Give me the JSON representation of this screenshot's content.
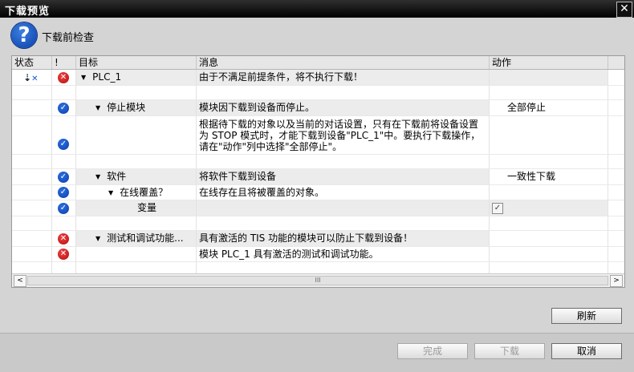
{
  "window": {
    "title": "下载预览",
    "close_glyph": "✕"
  },
  "header": {
    "icon": "help-icon",
    "text": "下载前检查"
  },
  "columns": [
    "状态",
    "!",
    "目标",
    "消息",
    "动作"
  ],
  "rows": [
    {
      "status_icon": "download-load-icon",
      "severity": "error",
      "target": "PLC_1",
      "message": "由于不满足前提条件，将不执行下载！",
      "action": ""
    },
    {
      "status_icon": "",
      "severity": "",
      "target": "",
      "message": "",
      "action": ""
    },
    {
      "status_icon": "",
      "severity": "ok",
      "target": "停止模块",
      "message": "模块因下载到设备而停止。",
      "action": "全部停止"
    },
    {
      "status_icon": "",
      "severity": "ok",
      "target": "",
      "message": "根据待下载的对象以及当前的对话设置，只有在下载前将设备设置为 STOP 模式时，才能下载到设备\"PLC_1\"中。要执行下载操作，请在\"动作\"列中选择\"全部停止\"。",
      "action": ""
    },
    {
      "status_icon": "",
      "severity": "",
      "target": "",
      "message": "",
      "action": ""
    },
    {
      "status_icon": "",
      "severity": "ok",
      "target": "软件",
      "message": "将软件下载到设备",
      "action": "一致性下载"
    },
    {
      "status_icon": "",
      "severity": "ok",
      "target": "在线覆盖？",
      "message": "在线存在且将被覆盖的对象。",
      "action": ""
    },
    {
      "status_icon": "",
      "severity": "ok",
      "target": "变量",
      "message": "",
      "action": "",
      "checked": true
    },
    {
      "status_icon": "",
      "severity": "",
      "target": "",
      "message": "",
      "action": ""
    },
    {
      "status_icon": "",
      "severity": "error",
      "target": "测试和调试功能...",
      "message": "具有激活的 TIS 功能的模块可以防止下载到设备！",
      "action": ""
    },
    {
      "status_icon": "",
      "severity": "error",
      "target": "",
      "message": "模块 PLC_1 具有激活的测试和调试功能。",
      "action": ""
    }
  ],
  "scrollbar": {
    "left_glyph": "<",
    "right_glyph": ">",
    "thumb_glyph": "III"
  },
  "buttons": {
    "refresh": "刷新",
    "finish": "完成",
    "download": "下载",
    "cancel": "取消"
  },
  "icons": {
    "ok_glyph": "✓",
    "error_glyph": "✕",
    "expand_glyph": "▼",
    "check_glyph": "✓",
    "help_glyph": "?"
  },
  "colors": {
    "ok": "#0b3fae",
    "error": "#c41414",
    "titlebar": "#000000"
  }
}
